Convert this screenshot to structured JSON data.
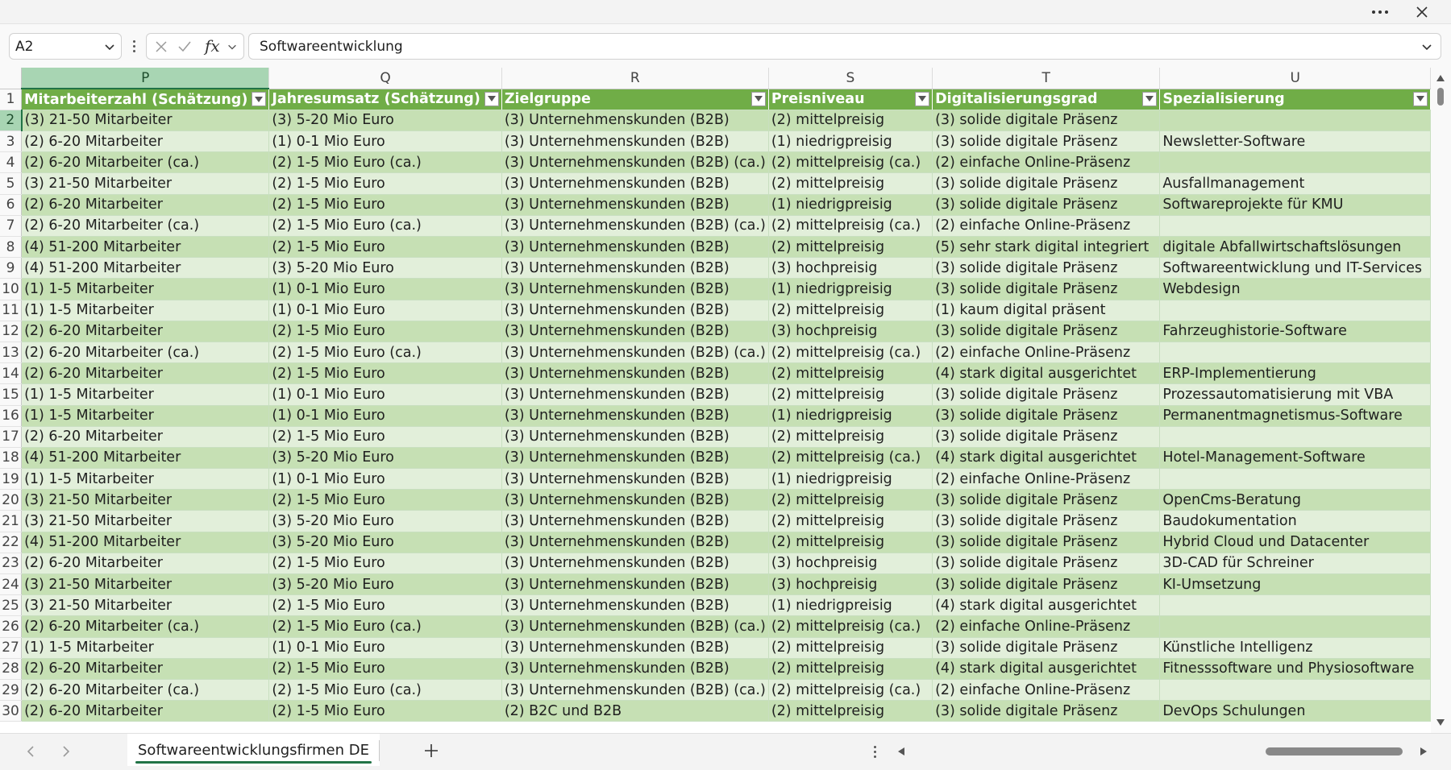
{
  "window": {
    "more_label": "More options",
    "close_label": "Close"
  },
  "formula_bar": {
    "cell_reference": "A2",
    "fx_label": "fx",
    "formula_value": "Softwareentwicklung"
  },
  "columns": [
    {
      "letter": "P",
      "header": "Mitarbeiterzahl (Schätzung)"
    },
    {
      "letter": "Q",
      "header": "Jahresumsatz (Schätzung)"
    },
    {
      "letter": "R",
      "header": "Zielgruppe"
    },
    {
      "letter": "S",
      "header": "Preisniveau"
    },
    {
      "letter": "T",
      "header": "Digitalisierungsgrad"
    },
    {
      "letter": "U",
      "header": "Spezialisierung"
    }
  ],
  "rows": [
    {
      "num": "2",
      "cells": [
        "(3) 21-50 Mitarbeiter",
        "(3) 5-20 Mio Euro",
        "(3) Unternehmenskunden (B2B)",
        "(2) mittelpreisig",
        "(3) solide digitale Präsenz",
        ""
      ]
    },
    {
      "num": "3",
      "cells": [
        "(2) 6-20 Mitarbeiter",
        "(1) 0-1 Mio Euro",
        "(3) Unternehmenskunden (B2B)",
        "(1) niedrigpreisig",
        "(3) solide digitale Präsenz",
        "Newsletter-Software"
      ]
    },
    {
      "num": "4",
      "cells": [
        "(2) 6-20 Mitarbeiter (ca.)",
        "(2) 1-5 Mio Euro (ca.)",
        "(3) Unternehmenskunden (B2B) (ca.)",
        "(2) mittelpreisig (ca.)",
        "(2) einfache Online-Präsenz",
        ""
      ]
    },
    {
      "num": "5",
      "cells": [
        "(3) 21-50 Mitarbeiter",
        "(2) 1-5 Mio Euro",
        "(3) Unternehmenskunden (B2B)",
        "(2) mittelpreisig",
        "(3) solide digitale Präsenz",
        "Ausfallmanagement"
      ]
    },
    {
      "num": "6",
      "cells": [
        "(2) 6-20 Mitarbeiter",
        "(2) 1-5 Mio Euro",
        "(3) Unternehmenskunden (B2B)",
        "(1) niedrigpreisig",
        "(3) solide digitale Präsenz",
        "Softwareprojekte für KMU"
      ]
    },
    {
      "num": "7",
      "cells": [
        "(2) 6-20 Mitarbeiter (ca.)",
        "(2) 1-5 Mio Euro (ca.)",
        "(3) Unternehmenskunden (B2B) (ca.)",
        "(2) mittelpreisig (ca.)",
        "(2) einfache Online-Präsenz",
        ""
      ]
    },
    {
      "num": "8",
      "cells": [
        "(4) 51-200 Mitarbeiter",
        "(2) 1-5 Mio Euro",
        "(3) Unternehmenskunden (B2B)",
        "(2) mittelpreisig",
        "(5) sehr stark digital integriert",
        "digitale Abfallwirtschaftslösungen"
      ]
    },
    {
      "num": "9",
      "cells": [
        "(4) 51-200 Mitarbeiter",
        "(3) 5-20 Mio Euro",
        "(3) Unternehmenskunden (B2B)",
        "(3) hochpreisig",
        "(3) solide digitale Präsenz",
        "Softwareentwicklung und IT-Services"
      ]
    },
    {
      "num": "10",
      "cells": [
        "(1) 1-5 Mitarbeiter",
        "(1) 0-1 Mio Euro",
        "(3) Unternehmenskunden (B2B)",
        "(1) niedrigpreisig",
        "(3) solide digitale Präsenz",
        "Webdesign"
      ]
    },
    {
      "num": "11",
      "cells": [
        "(1) 1-5 Mitarbeiter",
        "(1) 0-1 Mio Euro",
        "(3) Unternehmenskunden (B2B)",
        "(2) mittelpreisig",
        "(1) kaum digital präsent",
        ""
      ]
    },
    {
      "num": "12",
      "cells": [
        "(2) 6-20 Mitarbeiter",
        "(2) 1-5 Mio Euro",
        "(3) Unternehmenskunden (B2B)",
        "(3) hochpreisig",
        "(3) solide digitale Präsenz",
        "Fahrzeughistorie-Software"
      ]
    },
    {
      "num": "13",
      "cells": [
        "(2) 6-20 Mitarbeiter (ca.)",
        "(2) 1-5 Mio Euro (ca.)",
        "(3) Unternehmenskunden (B2B) (ca.)",
        "(2) mittelpreisig (ca.)",
        "(2) einfache Online-Präsenz",
        ""
      ]
    },
    {
      "num": "14",
      "cells": [
        "(2) 6-20 Mitarbeiter",
        "(2) 1-5 Mio Euro",
        "(3) Unternehmenskunden (B2B)",
        "(2) mittelpreisig",
        "(4) stark digital ausgerichtet",
        "ERP-Implementierung"
      ]
    },
    {
      "num": "15",
      "cells": [
        "(1) 1-5 Mitarbeiter",
        "(1) 0-1 Mio Euro",
        "(3) Unternehmenskunden (B2B)",
        "(2) mittelpreisig",
        "(3) solide digitale Präsenz",
        "Prozessautomatisierung mit VBA"
      ]
    },
    {
      "num": "16",
      "cells": [
        "(1) 1-5 Mitarbeiter",
        "(1) 0-1 Mio Euro",
        "(3) Unternehmenskunden (B2B)",
        "(1) niedrigpreisig",
        "(3) solide digitale Präsenz",
        "Permanentmagnetismus-Software"
      ]
    },
    {
      "num": "17",
      "cells": [
        "(2) 6-20 Mitarbeiter",
        "(2) 1-5 Mio Euro",
        "(3) Unternehmenskunden (B2B)",
        "(2) mittelpreisig",
        "(3) solide digitale Präsenz",
        ""
      ]
    },
    {
      "num": "18",
      "cells": [
        "(4) 51-200 Mitarbeiter",
        "(3) 5-20 Mio Euro",
        "(3) Unternehmenskunden (B2B)",
        "(2) mittelpreisig (ca.)",
        "(4) stark digital ausgerichtet",
        "Hotel-Management-Software"
      ]
    },
    {
      "num": "19",
      "cells": [
        "(1) 1-5 Mitarbeiter",
        "(1) 0-1 Mio Euro",
        "(3) Unternehmenskunden (B2B)",
        "(1) niedrigpreisig",
        "(2) einfache Online-Präsenz",
        ""
      ]
    },
    {
      "num": "20",
      "cells": [
        "(3) 21-50 Mitarbeiter",
        "(2) 1-5 Mio Euro",
        "(3) Unternehmenskunden (B2B)",
        "(2) mittelpreisig",
        "(3) solide digitale Präsenz",
        "OpenCms-Beratung"
      ]
    },
    {
      "num": "21",
      "cells": [
        "(3) 21-50 Mitarbeiter",
        "(3) 5-20 Mio Euro",
        "(3) Unternehmenskunden (B2B)",
        "(2) mittelpreisig",
        "(3) solide digitale Präsenz",
        "Baudokumentation"
      ]
    },
    {
      "num": "22",
      "cells": [
        "(4) 51-200 Mitarbeiter",
        "(3) 5-20 Mio Euro",
        "(3) Unternehmenskunden (B2B)",
        "(2) mittelpreisig",
        "(3) solide digitale Präsenz",
        "Hybrid Cloud und Datacenter"
      ]
    },
    {
      "num": "23",
      "cells": [
        "(2) 6-20 Mitarbeiter",
        "(2) 1-5 Mio Euro",
        "(3) Unternehmenskunden (B2B)",
        "(3) hochpreisig",
        "(3) solide digitale Präsenz",
        "3D-CAD für Schreiner"
      ]
    },
    {
      "num": "24",
      "cells": [
        "(3) 21-50 Mitarbeiter",
        "(3) 5-20 Mio Euro",
        "(3) Unternehmenskunden (B2B)",
        "(3) hochpreisig",
        "(3) solide digitale Präsenz",
        "KI-Umsetzung"
      ]
    },
    {
      "num": "25",
      "cells": [
        "(3) 21-50 Mitarbeiter",
        "(2) 1-5 Mio Euro",
        "(3) Unternehmenskunden (B2B)",
        "(1) niedrigpreisig",
        "(4) stark digital ausgerichtet",
        ""
      ]
    },
    {
      "num": "26",
      "cells": [
        "(2) 6-20 Mitarbeiter (ca.)",
        "(2) 1-5 Mio Euro (ca.)",
        "(3) Unternehmenskunden (B2B) (ca.)",
        "(2) mittelpreisig (ca.)",
        "(2) einfache Online-Präsenz",
        ""
      ]
    },
    {
      "num": "27",
      "cells": [
        "(1) 1-5 Mitarbeiter",
        "(1) 0-1 Mio Euro",
        "(3) Unternehmenskunden (B2B)",
        "(2) mittelpreisig",
        "(3) solide digitale Präsenz",
        "Künstliche Intelligenz"
      ]
    },
    {
      "num": "28",
      "cells": [
        "(2) 6-20 Mitarbeiter",
        "(2) 1-5 Mio Euro",
        "(3) Unternehmenskunden (B2B)",
        "(2) mittelpreisig",
        "(4) stark digital ausgerichtet",
        "Fitnesssoftware und Physiosoftware"
      ]
    },
    {
      "num": "29",
      "cells": [
        "(2) 6-20 Mitarbeiter (ca.)",
        "(2) 1-5 Mio Euro (ca.)",
        "(3) Unternehmenskunden (B2B) (ca.)",
        "(2) mittelpreisig (ca.)",
        "(2) einfache Online-Präsenz",
        ""
      ]
    },
    {
      "num": "30",
      "cells": [
        "(2) 6-20 Mitarbeiter",
        "(2) 1-5 Mio Euro",
        "(2) B2C und B2B",
        "(2) mittelpreisig",
        "(3) solide digitale Präsenz",
        "DevOps Schulungen"
      ]
    }
  ],
  "sheet_tabs": [
    {
      "label": "Softwareentwicklungsfirmen DE",
      "active": true
    }
  ],
  "colors": {
    "header_fill": "#70ad47",
    "band_dark": "#c6e0b4",
    "band_light": "#e2efda",
    "selection": "#217346"
  },
  "icons": {
    "more": "more-horizontal-icon",
    "close": "close-icon",
    "cancel": "cancel-x-icon",
    "enter": "checkmark-icon",
    "function": "fx-icon",
    "filter": "filter-dropdown-icon",
    "add_sheet": "plus-icon"
  }
}
